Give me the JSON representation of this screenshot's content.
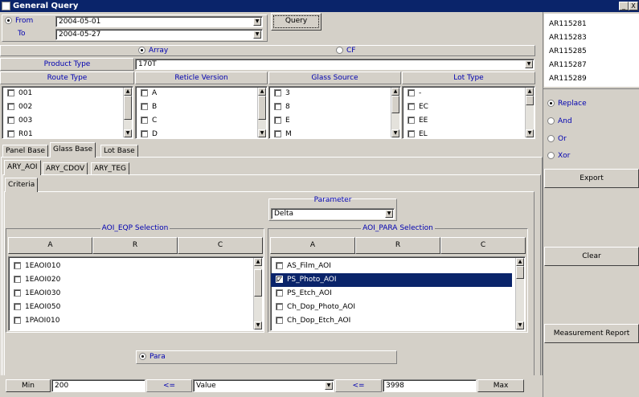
{
  "window": {
    "title": "General Query",
    "minimize": "_",
    "close": "X"
  },
  "date": {
    "from_label": "From",
    "from_value": "2004-05-01",
    "to_label": "To",
    "to_value": "2004-05-27",
    "query_label": "Query"
  },
  "mode": {
    "array_label": "Array",
    "cf_label": "CF",
    "selected": "Array"
  },
  "product": {
    "label": "Product Type",
    "value": "170T"
  },
  "filters": [
    {
      "header": "Route Type",
      "items": [
        "001",
        "002",
        "003",
        "R01"
      ]
    },
    {
      "header": "Reticle Version",
      "items": [
        "A",
        "B",
        "C",
        "D"
      ]
    },
    {
      "header": "Glass Source",
      "items": [
        "3",
        "8",
        "E",
        "M"
      ]
    },
    {
      "header": "Lot Type",
      "items": [
        "-",
        "EC",
        "EE",
        "EL"
      ]
    }
  ],
  "base_tabs": [
    "Panel Base",
    "Glass Base",
    "Lot  Base"
  ],
  "base_tab_active": "Glass Base",
  "sub_tabs": [
    "ARY_AOI",
    "ARY_CDOV",
    "ARY_TEG"
  ],
  "sub_tab_active": "ARY_AOI",
  "criteria_tab": "Criteria",
  "parameter": {
    "label": "Parameter",
    "value": "Delta"
  },
  "eqp": {
    "title": "AOI_EQP Selection",
    "columns": [
      "A",
      "R",
      "C"
    ],
    "items": [
      "1EAOI010",
      "1EAOI020",
      "1EAOI030",
      "1EAOI050",
      "1PAOI010"
    ]
  },
  "para": {
    "title": "AOI_PARA Selection",
    "columns": [
      "A",
      "R",
      "C"
    ],
    "items": [
      "AS_Film_AOI",
      "PS_Photo_AOI",
      "PS_Etch_AOI",
      "Ch_Dop_Photo_AOI",
      "Ch_Dop_Etch_AOI"
    ],
    "selected": "PS_Photo_AOI"
  },
  "para_radio": "Para",
  "range": {
    "min_label": "Min",
    "min_value": "200",
    "op1": "<=",
    "field_value": "Value",
    "op2": "<=",
    "max_value": "3998",
    "max_label": "Max"
  },
  "right": {
    "results": [
      "AR115281",
      "AR115283",
      "AR115285",
      "AR115287",
      "AR115289"
    ],
    "logic": [
      "Replace",
      "And",
      "Or",
      "Xor"
    ],
    "logic_selected": "Replace",
    "export": "Export",
    "clear": "Clear",
    "report": "Measurement Report"
  }
}
